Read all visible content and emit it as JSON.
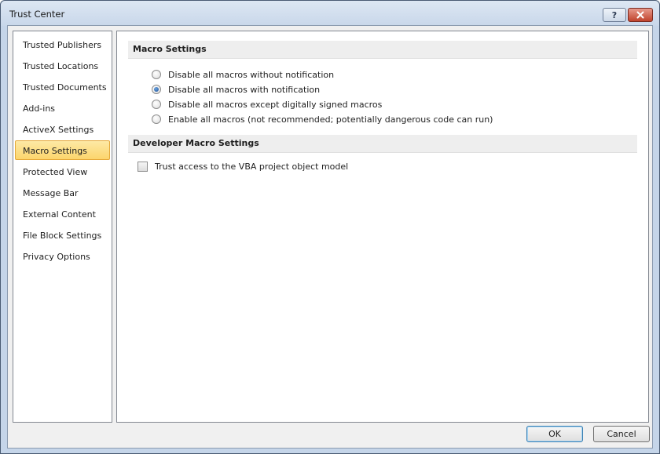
{
  "window": {
    "title": "Trust Center",
    "help_label": "?"
  },
  "sidebar": {
    "items": [
      {
        "label": "Trusted Publishers",
        "selected": false
      },
      {
        "label": "Trusted Locations",
        "selected": false
      },
      {
        "label": "Trusted Documents",
        "selected": false
      },
      {
        "label": "Add-ins",
        "selected": false
      },
      {
        "label": "ActiveX Settings",
        "selected": false
      },
      {
        "label": "Macro Settings",
        "selected": true
      },
      {
        "label": "Protected View",
        "selected": false
      },
      {
        "label": "Message Bar",
        "selected": false
      },
      {
        "label": "External Content",
        "selected": false
      },
      {
        "label": "File Block Settings",
        "selected": false
      },
      {
        "label": "Privacy Options",
        "selected": false
      }
    ]
  },
  "main": {
    "macro_section": {
      "title": "Macro Settings",
      "options": [
        {
          "label": "Disable all macros without notification",
          "checked": false
        },
        {
          "label": "Disable all macros with notification",
          "checked": true
        },
        {
          "label": "Disable all macros except digitally signed macros",
          "checked": false
        },
        {
          "label": "Enable all macros (not recommended; potentially dangerous code can run)",
          "checked": false
        }
      ]
    },
    "developer_section": {
      "title": "Developer Macro Settings",
      "vba_label": "Trust access to the VBA project object model",
      "vba_checked": false
    }
  },
  "footer": {
    "ok_label": "OK",
    "cancel_label": "Cancel"
  },
  "colors": {
    "selection": "#fcd56c",
    "selection_border": "#e5a838",
    "window_frame": "#c5d5e9",
    "close_button": "#c0432c"
  }
}
